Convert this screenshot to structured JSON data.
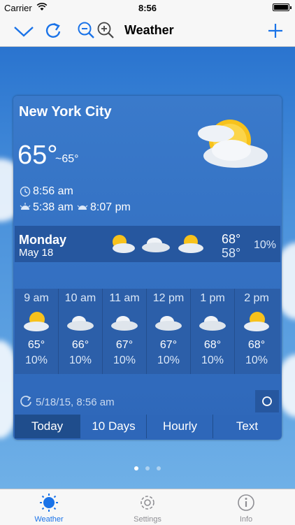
{
  "status_bar": {
    "carrier": "Carrier",
    "time": "8:56"
  },
  "nav": {
    "title": "Weather"
  },
  "card": {
    "city": "New York City",
    "temperature": "65°",
    "feels_like": "~65°",
    "current_time": "8:56 am",
    "sunrise": "5:38 am",
    "sunset": "8:07 pm",
    "day": {
      "name": "Monday",
      "date": "May 18",
      "high": "68°",
      "low": "58°",
      "precip": "10%"
    },
    "hourly": [
      {
        "time": "9 am",
        "temp": "65°",
        "precip": "10%",
        "icon": "partly-sunny-icon"
      },
      {
        "time": "10 am",
        "temp": "66°",
        "precip": "10%",
        "icon": "cloudy-icon"
      },
      {
        "time": "11 am",
        "temp": "67°",
        "precip": "10%",
        "icon": "cloudy-icon"
      },
      {
        "time": "12 pm",
        "temp": "67°",
        "precip": "10%",
        "icon": "cloudy-icon"
      },
      {
        "time": "1 pm",
        "temp": "68°",
        "precip": "10%",
        "icon": "cloudy-icon"
      },
      {
        "time": "2 pm",
        "temp": "68°",
        "precip": "10%",
        "icon": "partly-sunny-icon"
      }
    ],
    "updated": "5/18/15, 8:56 am",
    "tabs": [
      "Today",
      "10 Days",
      "Hourly",
      "Text"
    ],
    "active_tab": "Today"
  },
  "tab_bar": {
    "items": [
      {
        "label": "Weather",
        "icon": "sun-icon"
      },
      {
        "label": "Settings",
        "icon": "gear-icon"
      },
      {
        "label": "Info",
        "icon": "info-icon"
      }
    ],
    "active": "Weather"
  },
  "colors": {
    "accent": "#1a73e8",
    "card": "#2e67b9"
  }
}
